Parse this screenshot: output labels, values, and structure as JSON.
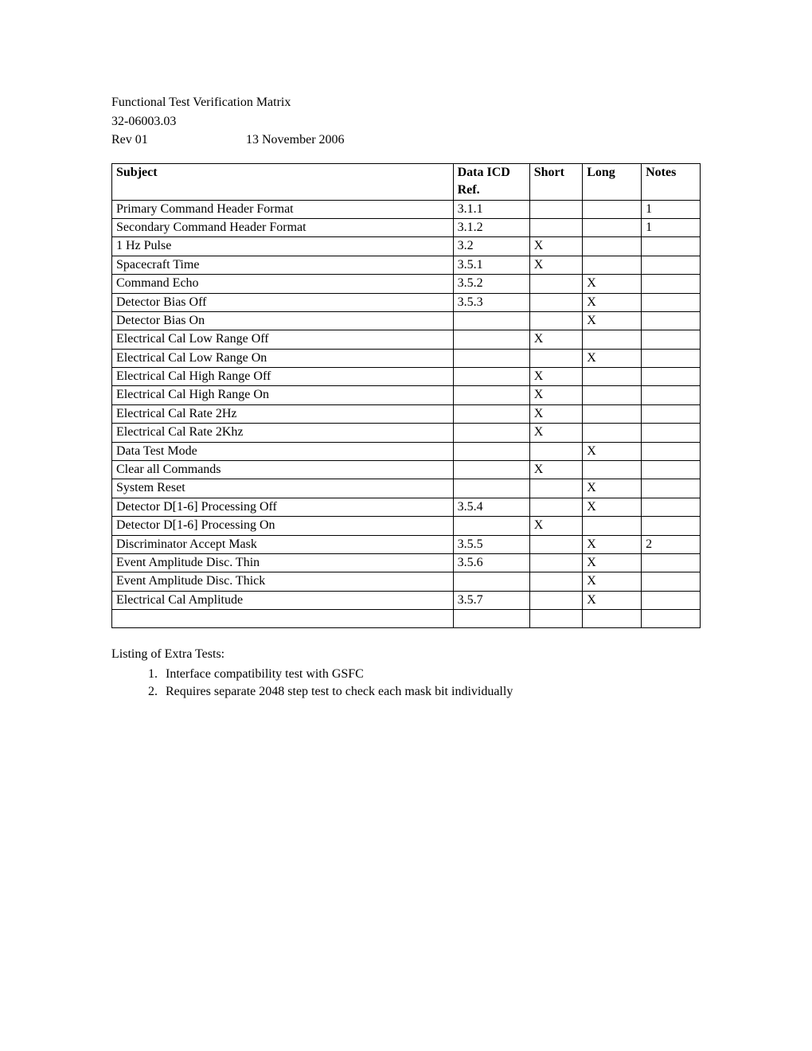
{
  "header": {
    "title": "Functional Test Verification Matrix",
    "doc_no": "32-06003.03",
    "rev": "Rev 01",
    "date": "13 November 2006"
  },
  "table": {
    "columns": {
      "subject": "Subject",
      "ref": "Data ICD Ref.",
      "short": "Short",
      "long": "Long",
      "notes": "Notes"
    },
    "rows": [
      {
        "subject": "Primary Command Header Format",
        "ref": "3.1.1",
        "short": "",
        "long": "",
        "notes": "1"
      },
      {
        "subject": "Secondary Command Header Format",
        "ref": "3.1.2",
        "short": "",
        "long": "",
        "notes": "1"
      },
      {
        "subject": "1 Hz Pulse",
        "ref": "3.2",
        "short": "X",
        "long": "",
        "notes": ""
      },
      {
        "subject": "Spacecraft Time",
        "ref": "3.5.1",
        "short": "X",
        "long": "",
        "notes": ""
      },
      {
        "subject": "Command Echo",
        "ref": "3.5.2",
        "short": "",
        "long": "X",
        "notes": ""
      },
      {
        "subject": "Detector Bias Off",
        "ref": "3.5.3",
        "short": "",
        "long": "X",
        "notes": ""
      },
      {
        "subject": "Detector Bias On",
        "ref": "",
        "short": "",
        "long": "X",
        "notes": ""
      },
      {
        "subject": "Electrical Cal Low Range Off",
        "ref": "",
        "short": "X",
        "long": "",
        "notes": ""
      },
      {
        "subject": "Electrical Cal Low Range On",
        "ref": "",
        "short": "",
        "long": "X",
        "notes": ""
      },
      {
        "subject": "Electrical Cal High Range Off",
        "ref": "",
        "short": "X",
        "long": "",
        "notes": ""
      },
      {
        "subject": "Electrical Cal High Range On",
        "ref": "",
        "short": "X",
        "long": "",
        "notes": ""
      },
      {
        "subject": "Electrical Cal Rate 2Hz",
        "ref": "",
        "short": "X",
        "long": "",
        "notes": ""
      },
      {
        "subject": "Electrical Cal Rate 2Khz",
        "ref": "",
        "short": "X",
        "long": "",
        "notes": ""
      },
      {
        "subject": "Data Test Mode",
        "ref": "",
        "short": "",
        "long": "X",
        "notes": ""
      },
      {
        "subject": "Clear all Commands",
        "ref": "",
        "short": "X",
        "long": "",
        "notes": ""
      },
      {
        "subject": "System Reset",
        "ref": "",
        "short": "",
        "long": "X",
        "notes": ""
      },
      {
        "subject": "Detector D[1-6] Processing Off",
        "ref": "3.5.4",
        "short": "",
        "long": "X",
        "notes": ""
      },
      {
        "subject": "Detector D[1-6] Processing On",
        "ref": "",
        "short": "X",
        "long": "",
        "notes": ""
      },
      {
        "subject": "Discriminator Accept Mask",
        "ref": "3.5.5",
        "short": "",
        "long": "X",
        "notes": "2"
      },
      {
        "subject": "Event Amplitude Disc. Thin",
        "ref": "3.5.6",
        "short": "",
        "long": "X",
        "notes": ""
      },
      {
        "subject": "Event Amplitude Disc. Thick",
        "ref": "",
        "short": "",
        "long": "X",
        "notes": ""
      },
      {
        "subject": "Electrical Cal Amplitude",
        "ref": "3.5.7",
        "short": "",
        "long": "X",
        "notes": ""
      },
      {
        "subject": "",
        "ref": "",
        "short": "",
        "long": "",
        "notes": ""
      }
    ]
  },
  "footer": {
    "heading": "Listing of Extra Tests:",
    "items": [
      "Interface compatibility test with GSFC",
      "Requires separate 2048 step test to check each mask bit individually"
    ]
  }
}
